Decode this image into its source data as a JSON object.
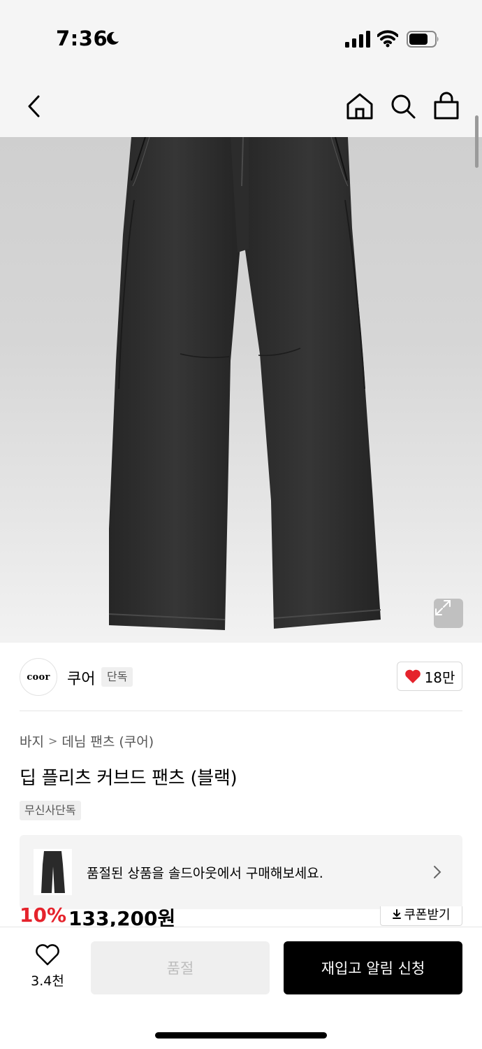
{
  "status_bar": {
    "time": "7:36"
  },
  "icons": {
    "back": "chevron-left-icon",
    "home": "home-icon",
    "search": "search-icon",
    "bag": "shopping-bag-icon",
    "expand": "expand-icon",
    "heart": "heart-icon",
    "chevron": "chevron-right-icon",
    "download": "download-icon"
  },
  "brand": {
    "logo_text": "coor",
    "name": "쿠어",
    "badge": "단독",
    "like_count": "18만"
  },
  "breadcrumb": {
    "category": "바지",
    "separator": ">",
    "subcategory": "데님 팬츠 (쿠어)"
  },
  "product": {
    "title": "딥 플리츠 커브드 팬츠 (블랙)",
    "tag": "무신사단독"
  },
  "soldout_banner": {
    "text": "품절된 상품을 솔드아웃에서 구매해보세요."
  },
  "price": {
    "discount": "10%",
    "amount": "133,200원",
    "coupon_label": "쿠폰받기"
  },
  "bottom_bar": {
    "like_count": "3.4천",
    "soldout_label": "품절",
    "restock_label": "재입고 알림 신청"
  },
  "colors": {
    "accent_red": "#e5232c",
    "primary_black": "#000000"
  }
}
